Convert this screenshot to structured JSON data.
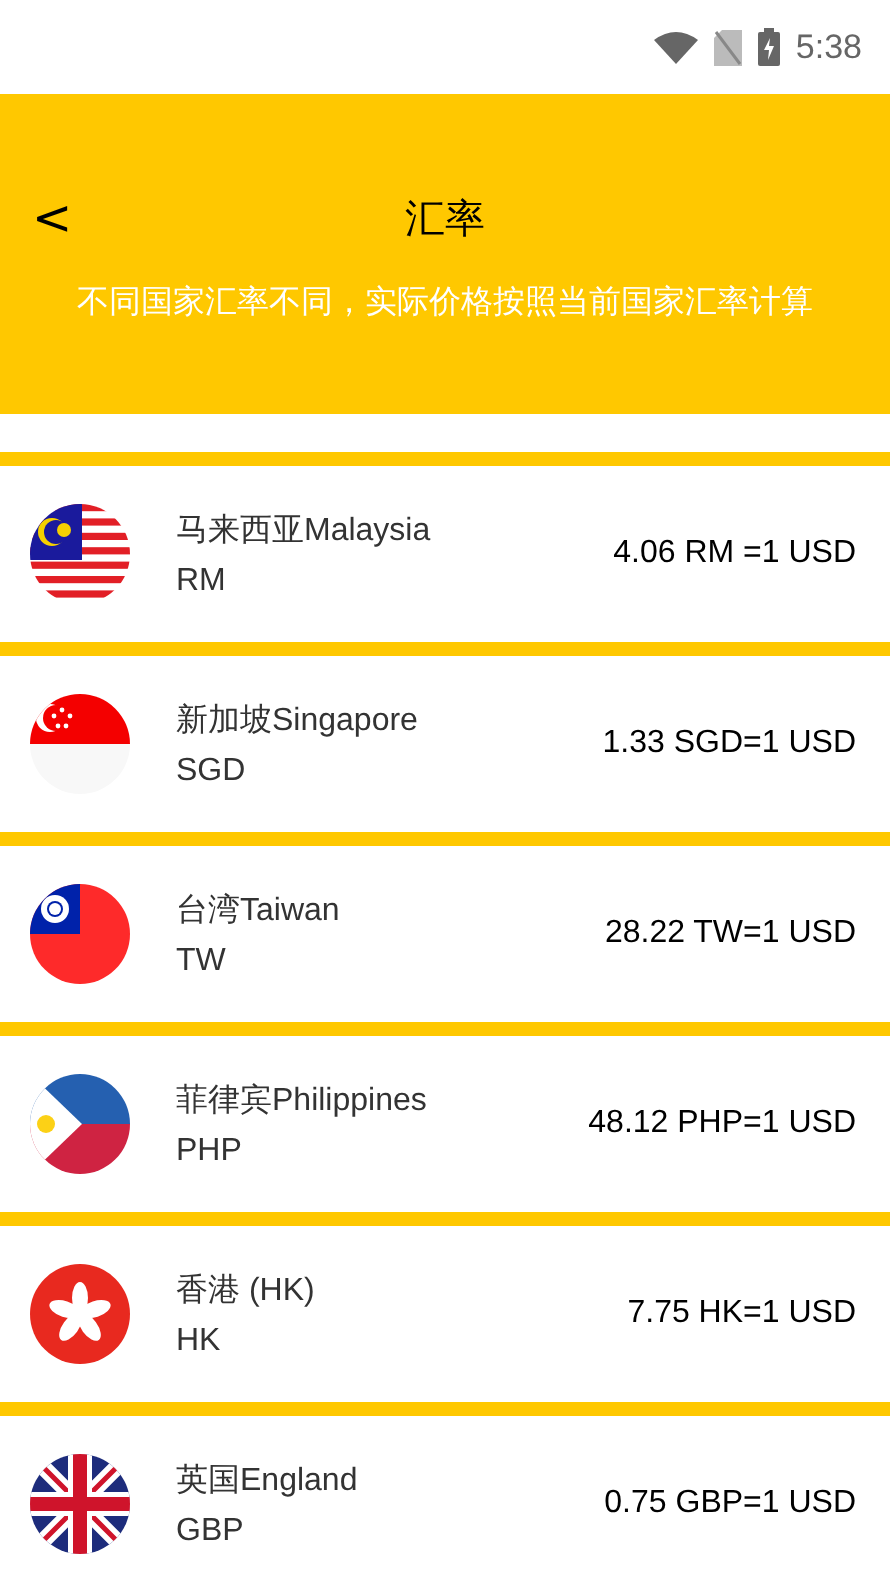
{
  "status_bar": {
    "time": "5:38"
  },
  "header": {
    "back": "<",
    "title": "汇率",
    "note": "不同国家汇率不同，实际价格按照当前国家汇率计算"
  },
  "rates": [
    {
      "name": "马来西亚Malaysia",
      "code": "RM",
      "rate": "4.06 RM =1 USD"
    },
    {
      "name": "新加坡Singapore",
      "code": "SGD",
      "rate": "1.33 SGD=1 USD"
    },
    {
      "name": "台湾Taiwan",
      "code": "TW",
      "rate": "28.22 TW=1 USD"
    },
    {
      "name": "菲律宾Philippines",
      "code": "PHP",
      "rate": "48.12 PHP=1 USD"
    },
    {
      "name": "香港 (HK)",
      "code": "HK",
      "rate": "7.75 HK=1 USD"
    },
    {
      "name": "英国England",
      "code": "GBP",
      "rate": "0.75 GBP=1 USD"
    }
  ]
}
